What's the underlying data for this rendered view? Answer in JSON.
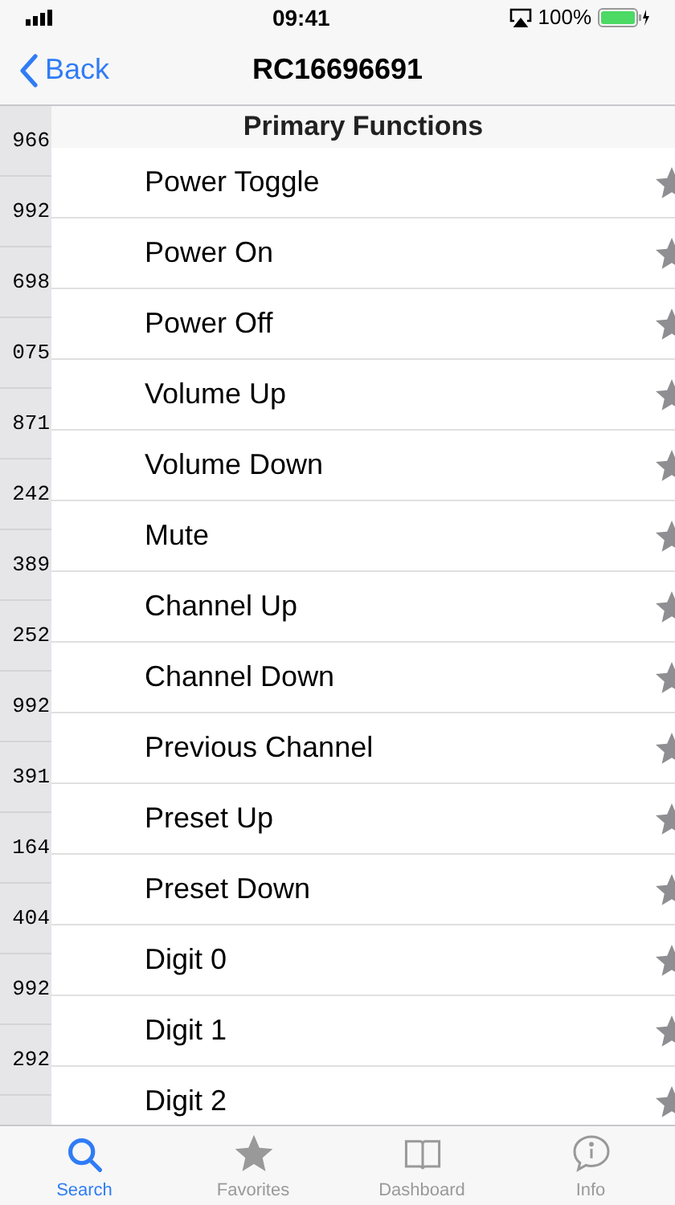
{
  "status_bar": {
    "time": "09:41",
    "battery": "100%"
  },
  "nav": {
    "back": "Back",
    "title": "RC16696691"
  },
  "index_column": [
    "966",
    "992",
    "698",
    "075",
    "871",
    "242",
    "389",
    "252",
    "992",
    "391",
    "164",
    "404",
    "992",
    "292"
  ],
  "section": {
    "title": "Primary Functions",
    "items": [
      {
        "label": "Power Toggle",
        "favorite": false
      },
      {
        "label": "Power On",
        "favorite": false
      },
      {
        "label": "Power Off",
        "favorite": false
      },
      {
        "label": "Volume Up",
        "favorite": false
      },
      {
        "label": "Volume Down",
        "favorite": false
      },
      {
        "label": "Mute",
        "favorite": false
      },
      {
        "label": "Channel Up",
        "favorite": false
      },
      {
        "label": "Channel Down",
        "favorite": false
      },
      {
        "label": "Previous Channel",
        "favorite": false
      },
      {
        "label": "Preset Up",
        "favorite": false
      },
      {
        "label": "Preset Down",
        "favorite": false
      },
      {
        "label": "Digit 0",
        "favorite": false
      },
      {
        "label": "Digit 1",
        "favorite": false
      },
      {
        "label": "Digit 2",
        "favorite": false
      }
    ]
  },
  "tab_bar": [
    {
      "kind": "search",
      "label": "Search",
      "selected": true
    },
    {
      "kind": "favorites",
      "label": "Favorites",
      "selected": false
    },
    {
      "kind": "dashboard",
      "label": "Dashboard",
      "selected": false
    },
    {
      "kind": "info",
      "label": "Info",
      "selected": false
    }
  ]
}
